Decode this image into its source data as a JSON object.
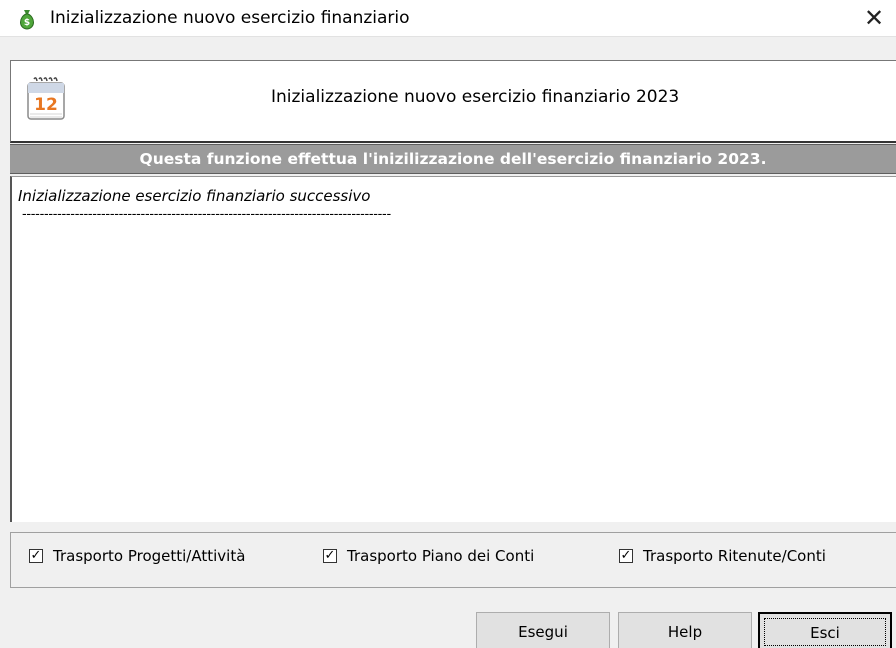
{
  "window": {
    "title": "Inizializzazione nuovo esercizio finanziario",
    "title_icon": "money-bag-icon",
    "close_glyph": "✕"
  },
  "header": {
    "icon": "calendar-icon",
    "calendar_day": "12",
    "title": "Inizializzazione nuovo esercizio finanziario 2023"
  },
  "info_band": {
    "text": "Questa funzione effettua l'inizilizzazione dell'esercizio finanziario 2023."
  },
  "log": {
    "lines": [
      "Inizializzazione esercizio finanziario successivo",
      "------------------------------------------------------------------------------------"
    ]
  },
  "options": [
    {
      "label": "Trasporto Progetti/Attività",
      "checked": true
    },
    {
      "label": "Trasporto Piano dei Conti",
      "checked": true
    },
    {
      "label": "Trasporto Ritenute/Conti",
      "checked": true
    }
  ],
  "buttons": {
    "run": "Esegui",
    "help": "Help",
    "exit": "Esci"
  },
  "colors": {
    "band_bg": "#9b9b9b",
    "band_text": "#ffffff",
    "dialog_bg": "#f0f0f0",
    "calendar_accent": "#e87722"
  }
}
